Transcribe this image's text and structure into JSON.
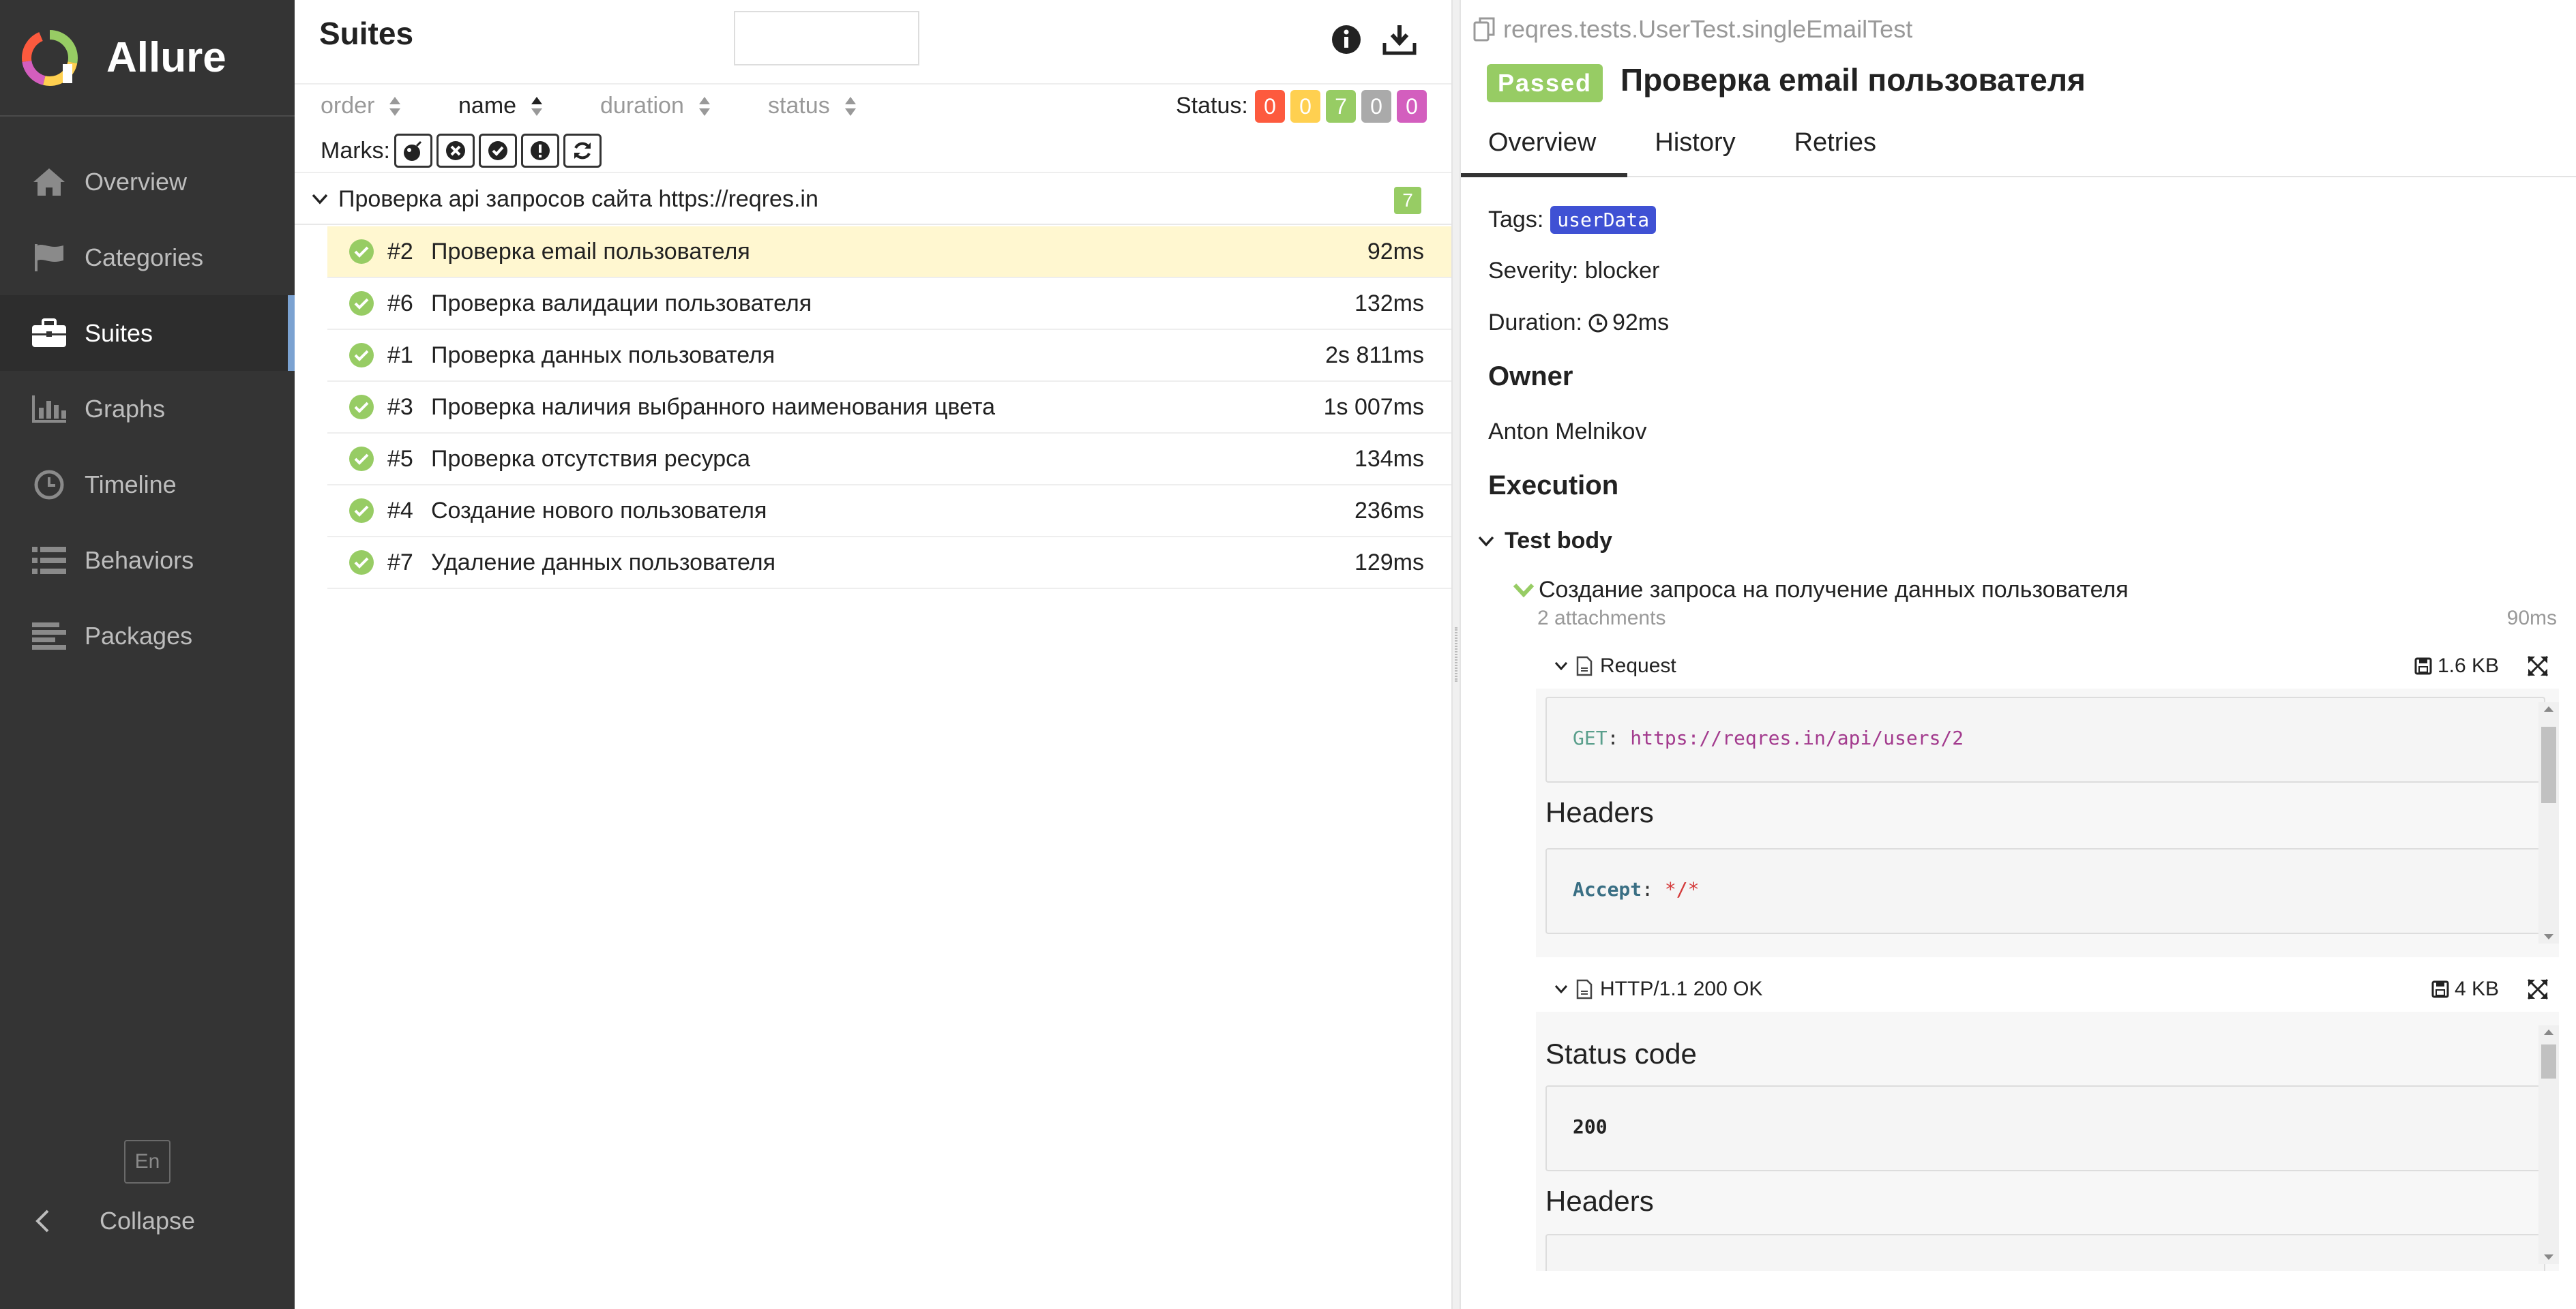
{
  "sidebar": {
    "brand": "Allure",
    "items": [
      {
        "label": "Overview",
        "icon": "home-icon"
      },
      {
        "label": "Categories",
        "icon": "flag-icon"
      },
      {
        "label": "Suites",
        "icon": "briefcase-icon",
        "active": true
      },
      {
        "label": "Graphs",
        "icon": "bar-chart-icon"
      },
      {
        "label": "Timeline",
        "icon": "clock-icon"
      },
      {
        "label": "Behaviors",
        "icon": "list-icon"
      },
      {
        "label": "Packages",
        "icon": "align-left-icon"
      }
    ],
    "lang": "En",
    "collapse": "Collapse"
  },
  "suites": {
    "title": "Suites",
    "search_value": "",
    "sort": {
      "order": "order",
      "name": "name",
      "duration": "duration",
      "status": "status"
    },
    "status_label": "Status:",
    "status_counts": [
      {
        "value": "0",
        "color": "#fd5a3e"
      },
      {
        "value": "0",
        "color": "#ffd050"
      },
      {
        "value": "7",
        "color": "#97cc64"
      },
      {
        "value": "0",
        "color": "#aaaaaa"
      },
      {
        "value": "0",
        "color": "#d35ebe"
      }
    ],
    "marks_label": "Marks:",
    "group": {
      "name": "Проверка api запросов сайта https://reqres.in",
      "count": "7"
    },
    "tests": [
      {
        "num": "#2",
        "name": "Проверка email пользователя",
        "duration": "92ms",
        "selected": true
      },
      {
        "num": "#6",
        "name": "Проверка валидации пользователя",
        "duration": "132ms"
      },
      {
        "num": "#1",
        "name": "Проверка данных пользователя",
        "duration": "2s 811ms"
      },
      {
        "num": "#3",
        "name": "Проверка наличия выбранного наименования цвета",
        "duration": "1s 007ms"
      },
      {
        "num": "#5",
        "name": "Проверка отсутствия ресурса",
        "duration": "134ms"
      },
      {
        "num": "#4",
        "name": "Создание нового пользователя",
        "duration": "236ms"
      },
      {
        "num": "#7",
        "name": "Удаление данных пользователя",
        "duration": "129ms"
      }
    ]
  },
  "detail": {
    "path": "reqres.tests.UserTest.singleEmailTest",
    "status": "Passed",
    "title": "Проверка email пользователя",
    "tabs": [
      "Overview",
      "History",
      "Retries"
    ],
    "tags_label": "Tags:",
    "tag": "userData",
    "severity_label": "Severity:",
    "severity": "blocker",
    "duration_label": "Duration:",
    "duration": "92ms",
    "owner_heading": "Owner",
    "owner": "Anton Melnikov",
    "execution_heading": "Execution",
    "test_body": "Test body",
    "step": {
      "title": "Создание запроса на получение данных пользователя",
      "attachments": "2 attachments",
      "duration": "90ms"
    },
    "request": {
      "name": "Request",
      "size": "1.6 KB",
      "method": "GET",
      "url": "https://reqres.in/api/users/2",
      "headers_heading": "Headers",
      "header_key": "Accept",
      "header_value": "*/*"
    },
    "response": {
      "name": "HTTP/1.1 200 OK",
      "size": "4 KB",
      "status_heading": "Status code",
      "status_code": "200",
      "headers_heading": "Headers"
    }
  }
}
